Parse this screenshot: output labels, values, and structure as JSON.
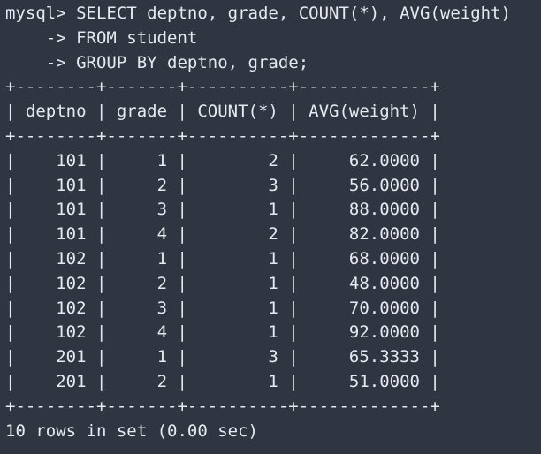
{
  "query": {
    "line1": "mysql> SELECT deptno, grade, COUNT(*), AVG(weight)",
    "line2": "    -> FROM student",
    "line3": "    -> GROUP BY deptno, grade;"
  },
  "table": {
    "border": "+--------+-------+----------+-------------+",
    "header": "| deptno | grade | COUNT(*) | AVG(weight) |",
    "rows": [
      "|    101 |     1 |        2 |     62.0000 |",
      "|    101 |     2 |        3 |     56.0000 |",
      "|    101 |     3 |        1 |     88.0000 |",
      "|    101 |     4 |        2 |     82.0000 |",
      "|    102 |     1 |        1 |     68.0000 |",
      "|    102 |     2 |        1 |     48.0000 |",
      "|    102 |     3 |        1 |     70.0000 |",
      "|    102 |     4 |        1 |     92.0000 |",
      "|    201 |     1 |        3 |     65.3333 |",
      "|    201 |     2 |        1 |     51.0000 |"
    ]
  },
  "status": "10 rows in set (0.00 sec)"
}
